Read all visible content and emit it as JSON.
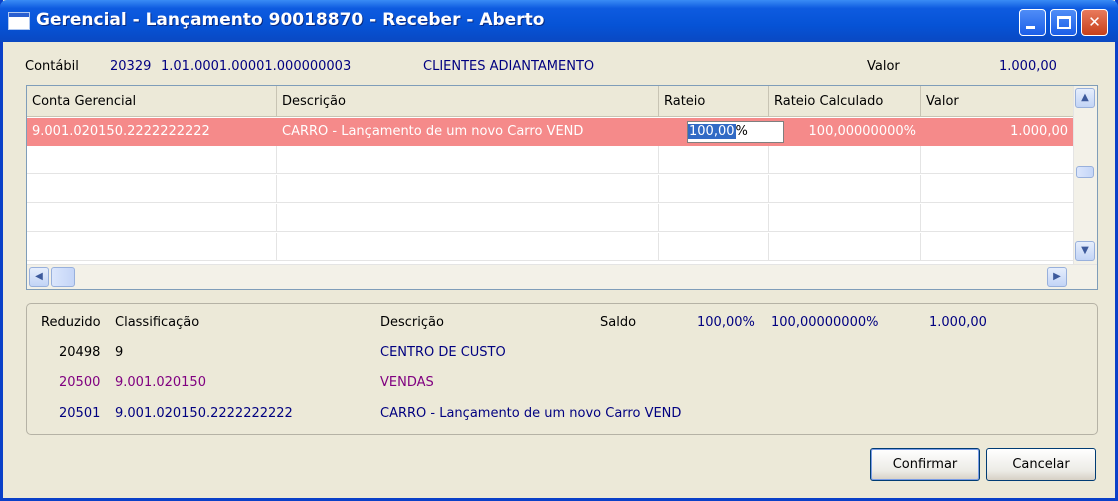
{
  "window": {
    "title": "Gerencial - Lançamento 90018870 - Receber - Aberto",
    "title_icon": "window-icon"
  },
  "header": {
    "contabil_label": "Contábil",
    "contabil_code": "20329",
    "contabil_account": "1.01.0001.00001.000000003",
    "contabil_description": "CLIENTES ADIANTAMENTO",
    "valor_label": "Valor",
    "valor_value": "1.000,00"
  },
  "grid": {
    "columns": [
      "Conta Gerencial",
      "Descrição",
      "Rateio",
      "Rateio Calculado",
      "Valor"
    ],
    "rows": [
      {
        "conta": "9.001.020150.2222222222",
        "descricao": "CARRO - Lançamento de um novo Carro VEND",
        "rateio_selected": "100,00",
        "rateio_rest": "%",
        "rateio_calculado": "100,00000000%",
        "valor": "1.000,00"
      }
    ]
  },
  "details": {
    "headers": {
      "reduzido": "Reduzido",
      "classificacao": "Classificação",
      "descricao": "Descrição",
      "saldo": "Saldo",
      "rateio_total": "100,00%",
      "rateio_calc_total": "100,00000000%",
      "valor_total": "1.000,00"
    },
    "rows": [
      {
        "reduzido": "20498",
        "classificacao": "9",
        "descricao": "CENTRO DE CUSTO"
      },
      {
        "reduzido": "20500",
        "classificacao": "9.001.020150",
        "descricao": "VENDAS"
      },
      {
        "reduzido": "20501",
        "classificacao": "9.001.020150.2222222222",
        "descricao": "CARRO - Lançamento de um novo Carro VEND"
      }
    ]
  },
  "buttons": {
    "confirm": "Confirmar",
    "cancel": "Cancelar"
  },
  "colors": {
    "selected_row": "#F58A8A",
    "titlebar": "#0653D6",
    "link_blue": "#000080",
    "purple": "#800080"
  }
}
